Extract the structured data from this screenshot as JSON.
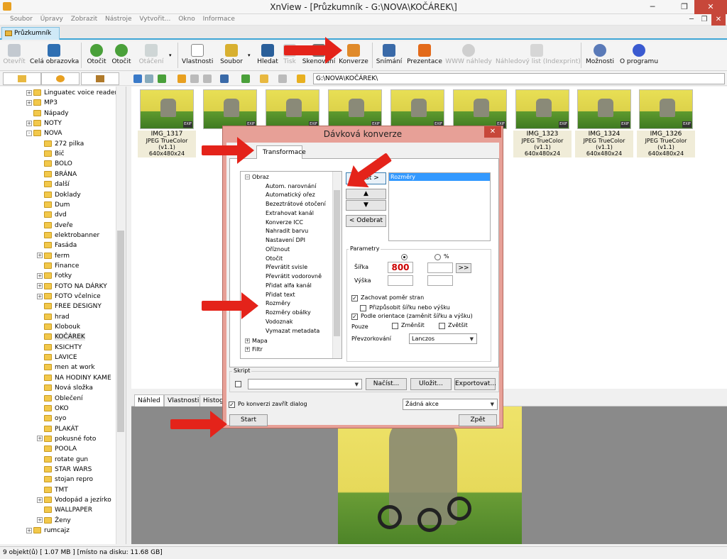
{
  "window": {
    "title": "XnView - [Průzkumník - G:\\NOVA\\KOČÁREK\\]"
  },
  "menu": [
    "Soubor",
    "Úpravy",
    "Zobrazit",
    "Nástroje",
    "Vytvořit...",
    "Okno",
    "Informace"
  ],
  "doc_tab": "Průzkumník",
  "toolbar": {
    "open": "Otevřít",
    "fullscreen": "Celá obrazovka",
    "rotate1": "Otočit",
    "rotate2": "Otočit",
    "rotation": "Otáčení",
    "properties": "Vlastnosti",
    "file": "Soubor",
    "find": "Hledat",
    "print": "Tisk",
    "scan": "Skenování",
    "convert": "Konverze",
    "capture": "Snímání",
    "slideshow": "Prezentace",
    "web": "WWW náhledy",
    "contact": "Náhledový list (Indexprint)",
    "options": "Možnosti",
    "about": "O programu"
  },
  "path": "G:\\NOVA\\KOČÁREK\\",
  "tree": {
    "items": [
      {
        "label": "Linguatec voice reader",
        "exp": "+"
      },
      {
        "label": "MP3",
        "exp": "+"
      },
      {
        "label": "Nápady",
        "exp": ""
      },
      {
        "label": "NOTY",
        "exp": "+"
      },
      {
        "label": "NOVA",
        "exp": "-"
      },
      {
        "label": "272 pilka",
        "exp": ""
      },
      {
        "label": "Bič",
        "exp": ""
      },
      {
        "label": "BOLO",
        "exp": ""
      },
      {
        "label": "BRÁNA",
        "exp": ""
      },
      {
        "label": "další",
        "exp": ""
      },
      {
        "label": "Doklady",
        "exp": ""
      },
      {
        "label": "Dum",
        "exp": ""
      },
      {
        "label": "dvd",
        "exp": ""
      },
      {
        "label": "dveře",
        "exp": ""
      },
      {
        "label": "elektrobanner",
        "exp": ""
      },
      {
        "label": "Fasáda",
        "exp": ""
      },
      {
        "label": "ferm",
        "exp": "+"
      },
      {
        "label": "Finance",
        "exp": ""
      },
      {
        "label": "Fotky",
        "exp": "+"
      },
      {
        "label": "FOTO NA DÁRKY",
        "exp": "+"
      },
      {
        "label": "FOTO včelnice",
        "exp": "+"
      },
      {
        "label": "FREE DESIGNY",
        "exp": ""
      },
      {
        "label": "hrad",
        "exp": ""
      },
      {
        "label": "Klobouk",
        "exp": ""
      },
      {
        "label": "KOČÁREK",
        "exp": ""
      },
      {
        "label": "KSICHTY",
        "exp": ""
      },
      {
        "label": "LAVICE",
        "exp": ""
      },
      {
        "label": "men at work",
        "exp": ""
      },
      {
        "label": "NA HODINY KAME",
        "exp": ""
      },
      {
        "label": "Nová složka",
        "exp": ""
      },
      {
        "label": "Oblečení",
        "exp": ""
      },
      {
        "label": "OKO",
        "exp": ""
      },
      {
        "label": "oyo",
        "exp": ""
      },
      {
        "label": "PLAKÁT",
        "exp": ""
      },
      {
        "label": "pokusné foto",
        "exp": "+"
      },
      {
        "label": "POOLA",
        "exp": ""
      },
      {
        "label": "rotate gun",
        "exp": ""
      },
      {
        "label": "STAR WARS",
        "exp": ""
      },
      {
        "label": "stojan repro",
        "exp": ""
      },
      {
        "label": "TMT",
        "exp": ""
      },
      {
        "label": "Vodopád a jezírko",
        "exp": "+"
      },
      {
        "label": "WALLPAPER",
        "exp": ""
      },
      {
        "label": "Ženy",
        "exp": "+"
      },
      {
        "label": "rumcajz",
        "exp": "+"
      }
    ]
  },
  "thumbs": [
    {
      "name": "IMG_1317",
      "fmt": "JPEG TrueColor (v1.1)",
      "size": "640x480x24"
    },
    {
      "name": "IMG_1323",
      "fmt": "JPEG TrueColor (v1.1)",
      "size": "640x480x24"
    },
    {
      "name": "IMG_1324",
      "fmt": "JPEG TrueColor (v1.1)",
      "size": "640x480x24"
    },
    {
      "name": "IMG_1326",
      "fmt": "JPEG TrueColor (v1.1)",
      "size": "640x480x24"
    }
  ],
  "exif": "EXIF",
  "bottom_tabs": [
    "Náhled",
    "Vlastnosti",
    "Histog"
  ],
  "status": "9 objekt(ů) [ 1.07 MB ] [místo na disku: 11.68 GB]",
  "dialog": {
    "title": "Dávková konverze",
    "tab": "Transformace",
    "group_image": "Obraz",
    "ops": [
      "Autom. narovnání",
      "Automatický ořez",
      "Bezeztrátové otočení",
      "Extrahovat kanál",
      "Konverze ICC",
      "Nahradit barvu",
      "Nastavení DPI",
      "Oříznout",
      "Otočit",
      "Převrátit svisle",
      "Převrátit vodorovně",
      "Přidat alfa kanál",
      "Přidat text",
      "Rozměry",
      "Rozměry obálky",
      "Vodoznak",
      "Vymazat metadata"
    ],
    "group_map": "Mapa",
    "group_filter": "Filtr",
    "add": "Přidat >",
    "up": "▲",
    "down": "▼",
    "remove": "< Odebrat",
    "selected": "Rozměry",
    "params": "Parametry",
    "percent": "%",
    "width_label": "Šířka",
    "width_value": "800",
    "height_label": "Výška",
    "more": ">>",
    "keep_ratio": "Zachovat poměr stran",
    "fit": "Přizpůsobit šířku nebo výšku",
    "orient": "Podle orientace (zaměnit šířku a výšku)",
    "only": "Pouze",
    "reduce": "Změnšit",
    "enlarge": "Zvětšit",
    "resample_label": "Převzorkování",
    "resample_value": "Lanczos",
    "script": "Skript",
    "load": "Načíst...",
    "save": "Uložit...",
    "export": "Exportovat...",
    "close_after": "Po konverzi zavřít dialog",
    "action": "Žádná akce",
    "start": "Start",
    "back": "Zpět"
  }
}
